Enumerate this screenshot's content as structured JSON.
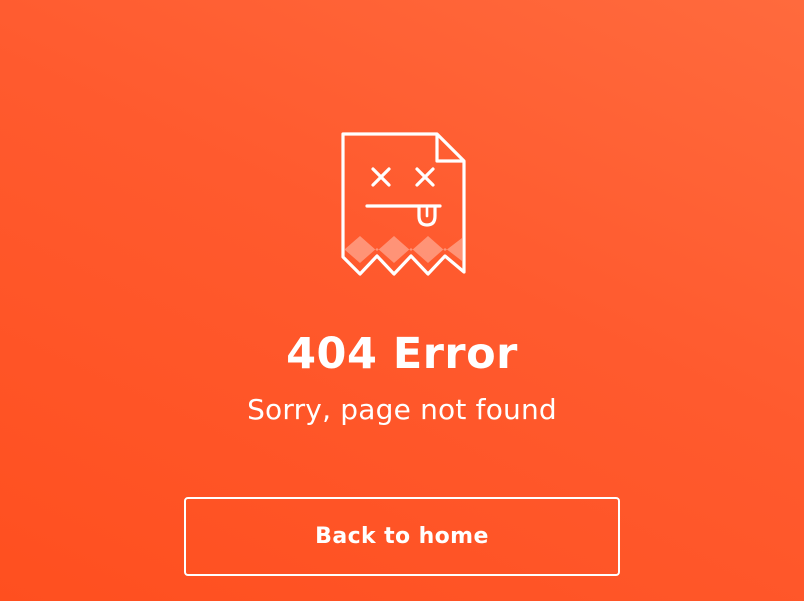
{
  "page": {
    "background_colors": [
      "#ff6a3d",
      "#ff4f1f"
    ],
    "illustration_icon": "broken-page-ghost-icon"
  },
  "error": {
    "title": "404 Error",
    "message": "Sorry, page not found"
  },
  "actions": {
    "home_label": "Back to home"
  }
}
